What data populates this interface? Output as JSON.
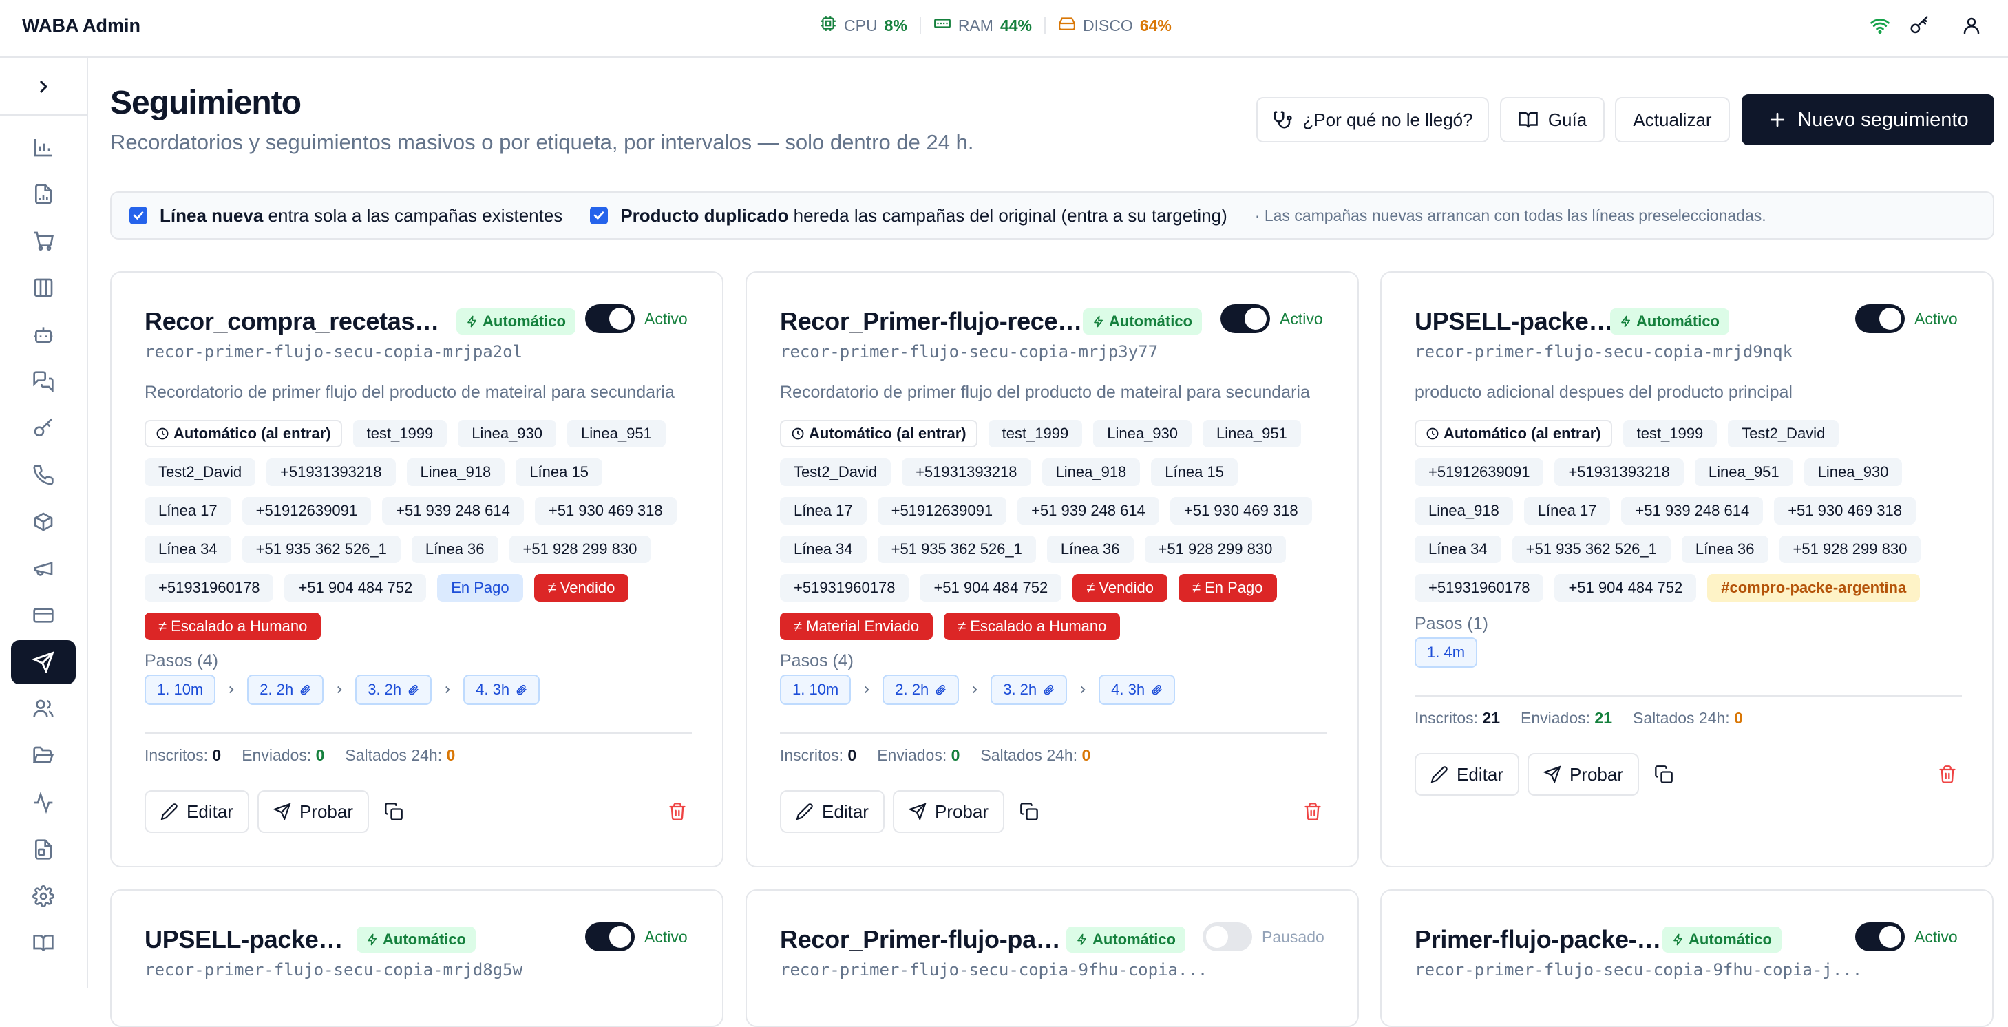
{
  "header": {
    "brand": "WABA Admin",
    "cpu_label": "CPU",
    "cpu_value": "8%",
    "ram_label": "RAM",
    "ram_value": "44%",
    "disk_label": "DISCO",
    "disk_value": "64%",
    "colors": {
      "cpu": "#15803d",
      "ram": "#15803d",
      "disk": "#d97706",
      "wifi": "#16a34a"
    }
  },
  "page": {
    "title": "Seguimiento",
    "subtitle": "Recordatorios y seguimientos masivos o por etiqueta, por intervalos — solo dentro de 24 h.",
    "btn_why": "¿Por qué no le llegó?",
    "btn_guide": "Guía",
    "btn_refresh": "Actualizar",
    "btn_new": "Nuevo seguimiento"
  },
  "options": {
    "opt1_bold": "Línea nueva",
    "opt1_rest": " entra sola a las campañas existentes",
    "opt2_bold": "Producto duplicado",
    "opt2_rest": " hereda las campañas del original (entra a su targeting)",
    "note": "· Las campañas nuevas arrancan con todas las líneas preseleccionadas."
  },
  "labels": {
    "automatic": "Automático",
    "active": "Activo",
    "paused": "Pausado",
    "enrolled": "Inscritos:",
    "sent": "Enviados:",
    "skipped": "Saltados 24h:",
    "edit": "Editar",
    "test": "Probar"
  },
  "cards": [
    {
      "title": "Recor_compra_recetasb-...",
      "slug": "recor-primer-flujo-secu-copia-mrjpa2ol",
      "description": "Recordatorio de primer flujo del producto de mateiral para secundaria",
      "tags": [
        {
          "text": "Automático (al entrar)",
          "kind": "trig"
        },
        {
          "text": "test_1999",
          "kind": "gray"
        },
        {
          "text": "Linea_930",
          "kind": "gray"
        },
        {
          "text": "Linea_951",
          "kind": "gray"
        },
        {
          "text": "Test2_David",
          "kind": "gray"
        },
        {
          "text": "+51931393218",
          "kind": "gray"
        },
        {
          "text": "Linea_918",
          "kind": "gray"
        },
        {
          "text": "Línea 15",
          "kind": "gray"
        },
        {
          "text": "Línea 17",
          "kind": "gray"
        },
        {
          "text": "+51912639091",
          "kind": "gray"
        },
        {
          "text": "+51 939 248 614",
          "kind": "gray"
        },
        {
          "text": "+51 930 469 318",
          "kind": "gray"
        },
        {
          "text": "Línea 34",
          "kind": "gray"
        },
        {
          "text": "+51 935 362 526_1",
          "kind": "gray"
        },
        {
          "text": "Línea 36",
          "kind": "gray"
        },
        {
          "text": "+51 928 299 830",
          "kind": "gray"
        },
        {
          "text": "+51931960178",
          "kind": "gray"
        },
        {
          "text": "+51 904 484 752",
          "kind": "gray"
        },
        {
          "text": "En Pago",
          "kind": "blue"
        },
        {
          "text": "≠ Vendido",
          "kind": "red"
        },
        {
          "text": "≠ Escalado a Humano",
          "kind": "red"
        }
      ],
      "pasos_label": "Pasos (4)",
      "steps": [
        "1. 10m",
        "2. 2h",
        "3. 2h",
        "4. 3h"
      ],
      "inscritos": "0",
      "enviados": "0",
      "saltados": "0"
    },
    {
      "title": "Recor_Primer-flujo-recet...",
      "slug": "recor-primer-flujo-secu-copia-mrjp3y77",
      "description": "Recordatorio de primer flujo del producto de mateiral para secundaria",
      "tags": [
        {
          "text": "Automático (al entrar)",
          "kind": "trig"
        },
        {
          "text": "test_1999",
          "kind": "gray"
        },
        {
          "text": "Linea_930",
          "kind": "gray"
        },
        {
          "text": "Linea_951",
          "kind": "gray"
        },
        {
          "text": "Test2_David",
          "kind": "gray"
        },
        {
          "text": "+51931393218",
          "kind": "gray"
        },
        {
          "text": "Linea_918",
          "kind": "gray"
        },
        {
          "text": "Línea 15",
          "kind": "gray"
        },
        {
          "text": "Línea 17",
          "kind": "gray"
        },
        {
          "text": "+51912639091",
          "kind": "gray"
        },
        {
          "text": "+51 939 248 614",
          "kind": "gray"
        },
        {
          "text": "+51 930 469 318",
          "kind": "gray"
        },
        {
          "text": "Línea 34",
          "kind": "gray"
        },
        {
          "text": "+51 935 362 526_1",
          "kind": "gray"
        },
        {
          "text": "Línea 36",
          "kind": "gray"
        },
        {
          "text": "+51 928 299 830",
          "kind": "gray"
        },
        {
          "text": "+51931960178",
          "kind": "gray"
        },
        {
          "text": "+51 904 484 752",
          "kind": "gray"
        },
        {
          "text": "≠ Vendido",
          "kind": "red"
        },
        {
          "text": "≠ En Pago",
          "kind": "red"
        },
        {
          "text": "≠ Material Enviado",
          "kind": "red"
        },
        {
          "text": "≠ Escalado a Humano",
          "kind": "red"
        }
      ],
      "pasos_label": "Pasos (4)",
      "steps": [
        "1. 10m",
        "2. 2h",
        "3. 2h",
        "4. 3h"
      ],
      "inscritos": "0",
      "enviados": "0",
      "saltados": "0"
    },
    {
      "title": "UPSELL-packe-arg",
      "slug": "recor-primer-flujo-secu-copia-mrjd9nqk",
      "description": "producto adicional despues del producto principal",
      "tags": [
        {
          "text": "Automático (al entrar)",
          "kind": "trig"
        },
        {
          "text": "test_1999",
          "kind": "gray"
        },
        {
          "text": "Test2_David",
          "kind": "gray"
        },
        {
          "text": "+51912639091",
          "kind": "gray"
        },
        {
          "text": "+51931393218",
          "kind": "gray"
        },
        {
          "text": "Linea_951",
          "kind": "gray"
        },
        {
          "text": "Linea_930",
          "kind": "gray"
        },
        {
          "text": "Linea_918",
          "kind": "gray"
        },
        {
          "text": "Línea 17",
          "kind": "gray"
        },
        {
          "text": "+51 939 248 614",
          "kind": "gray"
        },
        {
          "text": "+51 930 469 318",
          "kind": "gray"
        },
        {
          "text": "Línea 34",
          "kind": "gray"
        },
        {
          "text": "+51 935 362 526_1",
          "kind": "gray"
        },
        {
          "text": "Línea 36",
          "kind": "gray"
        },
        {
          "text": "+51 928 299 830",
          "kind": "gray"
        },
        {
          "text": "+51931960178",
          "kind": "gray"
        },
        {
          "text": "+51 904 484 752",
          "kind": "gray"
        },
        {
          "text": "#compro-packe-argentina",
          "kind": "yellow"
        }
      ],
      "pasos_label": "Pasos (1)",
      "steps": [
        "1. 4m"
      ],
      "inscritos": "21",
      "enviados": "21",
      "saltados": "0"
    },
    {
      "title": "UPSELL-packe-ecu",
      "slug": "recor-primer-flujo-secu-copia-mrjd8g5w",
      "status": "active"
    },
    {
      "title": "Recor_Primer-flujo-pac...",
      "slug": "recor-primer-flujo-secu-copia-9fhu-copia...",
      "status": "paused"
    },
    {
      "title": "Primer-flujo-packe-arg",
      "slug": "recor-primer-flujo-secu-copia-9fhu-copia-j...",
      "status": "active"
    }
  ]
}
